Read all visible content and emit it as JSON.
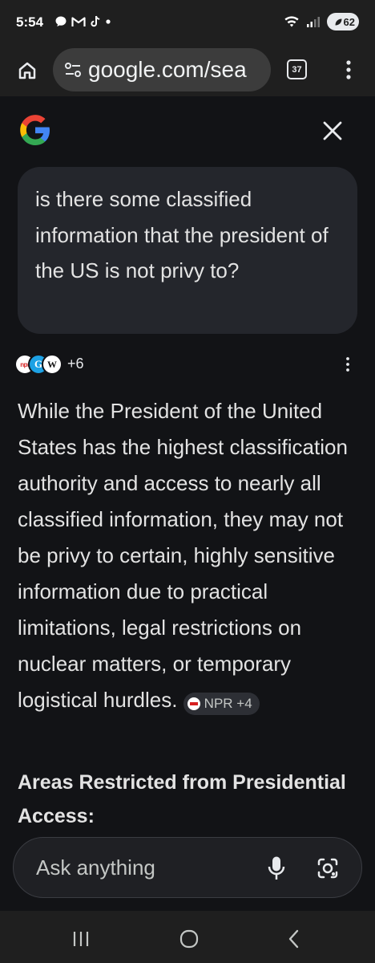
{
  "status_bar": {
    "time": "5:54",
    "battery": "62",
    "notification_icons": [
      "chat-bubble-icon",
      "gmail-icon",
      "tiktok-icon",
      "dot-icon"
    ]
  },
  "browser": {
    "url": "google.com/sea",
    "tab_count": "37"
  },
  "query": {
    "text": "is there some classified information that the president of the US is not privy to?"
  },
  "sources": {
    "icons": [
      "npr",
      "g",
      "wp"
    ],
    "npr_label": "npr",
    "g_label": "G",
    "wp_label": "W",
    "count": "+6"
  },
  "answer": {
    "text": "While the President of the United States has the highest classification authority and access to nearly all classified information, they may not be privy to certain, highly sensitive information due to practical limitations, legal restrictions on nuclear matters, or temporary logistical hurdles.",
    "citation": "NPR +4"
  },
  "section": {
    "heading": "Areas Restricted from Presidential Access:"
  },
  "ask_bar": {
    "placeholder": "Ask anything"
  },
  "colors": {
    "background": "#121316",
    "bubble": "#24262c",
    "text": "#e3e3e3",
    "accent_red": "#d62021"
  }
}
